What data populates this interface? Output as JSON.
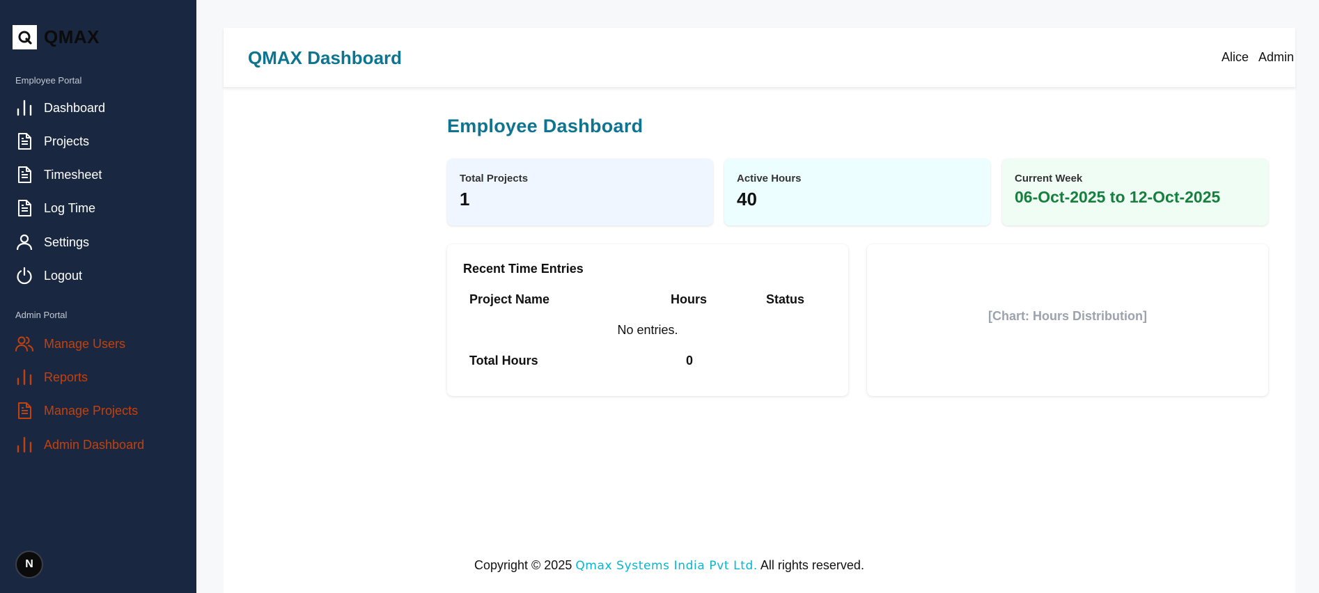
{
  "brand": {
    "name": "QMAX",
    "logo_letter": "Q"
  },
  "sidebar": {
    "employee_section": "Employee Portal",
    "employee_items": [
      {
        "label": "Dashboard",
        "icon": "bar-chart-icon"
      },
      {
        "label": "Projects",
        "icon": "document-icon"
      },
      {
        "label": "Timesheet",
        "icon": "document-icon"
      },
      {
        "label": "Log Time",
        "icon": "document-icon"
      },
      {
        "label": "Settings",
        "icon": "user-icon"
      },
      {
        "label": "Logout",
        "icon": "power-icon"
      }
    ],
    "admin_section": "Admin Portal",
    "admin_items": [
      {
        "label": "Manage Users",
        "icon": "users-icon"
      },
      {
        "label": "Reports",
        "icon": "bar-chart-icon"
      },
      {
        "label": "Manage Projects",
        "icon": "document-icon"
      },
      {
        "label": "Admin Dashboard",
        "icon": "bar-chart-icon"
      }
    ],
    "fab_letter": "N"
  },
  "header": {
    "title": "QMAX Dashboard",
    "user_name": "Alice",
    "user_role": "Admin"
  },
  "dashboard": {
    "title": "Employee Dashboard",
    "stats": [
      {
        "label": "Total Projects",
        "value": "1"
      },
      {
        "label": "Active Hours",
        "value": "40"
      },
      {
        "label": "Current Week",
        "value": "06-Oct-2025 to 12-Oct-2025"
      }
    ],
    "recent_entries": {
      "title": "Recent Time Entries",
      "columns": [
        "Project Name",
        "Hours",
        "Status"
      ],
      "empty_text": "No entries.",
      "total_label": "Total Hours",
      "total_value": "0"
    },
    "chart_placeholder": "[Chart: Hours Distribution]"
  },
  "footer": {
    "prefix": "Copyright © 2025",
    "company": "Qmax Systems India Pvt Ltd.",
    "suffix": "All rights reserved."
  },
  "colors": {
    "sidebar_bg": "#1a2740",
    "accent": "#0e7490",
    "admin_link": "#c2410c",
    "week_value": "#15803d",
    "footer_company": "#06b6d4"
  }
}
